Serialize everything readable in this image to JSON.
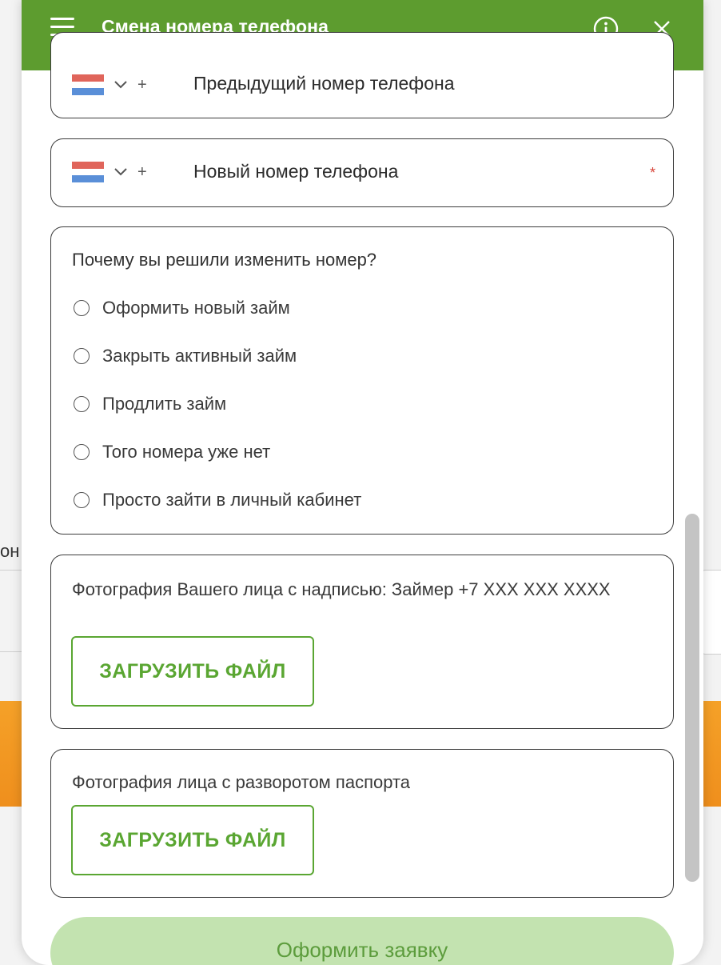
{
  "background": {
    "partial_label": "он"
  },
  "header": {
    "title": "Смена номера телефона",
    "menu_icon": "hamburger-menu-icon",
    "info_icon": "info-circle-icon",
    "close_icon": "close-icon",
    "background_color": "#5d9c2f"
  },
  "previous_phone": {
    "country_flag": "Netherlands",
    "prefix": "+",
    "label": "Предыдущий номер телефона"
  },
  "new_phone": {
    "country_flag": "Netherlands",
    "prefix": "+",
    "label": "Новый номер телефона",
    "required_mark": "*"
  },
  "reason": {
    "question": "Почему вы решили изменить номер?",
    "options": [
      "Оформить новый займ",
      "Закрыть активный займ",
      "Продлить займ",
      "Того номера уже нет",
      "Просто зайти в личный кабинет"
    ]
  },
  "upload_face": {
    "text": "Фотография Вашего лица с надписью: Займер +7 XXX XXX XXXX",
    "button": "ЗАГРУЗИТЬ ФАЙЛ"
  },
  "upload_passport": {
    "text": "Фотография лица с разворотом паспорта",
    "button": "ЗАГРУЗИТЬ ФАЙЛ"
  },
  "submit": {
    "label": "Оформить заявку"
  },
  "colors": {
    "brand_green": "#5d9c2f",
    "button_green": "#5aa632",
    "submit_disabled": "#c3e3b0",
    "required_red": "#d8463b"
  }
}
